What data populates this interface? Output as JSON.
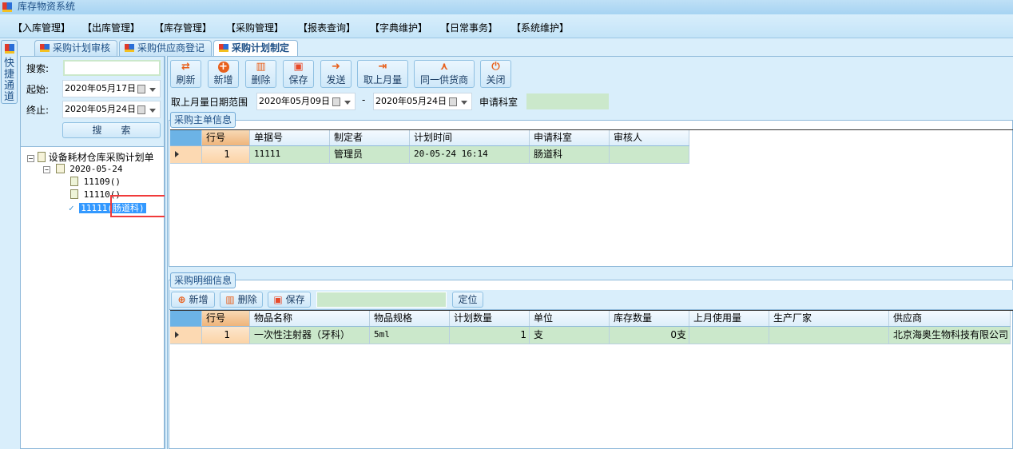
{
  "app": {
    "title": "库存物资系统"
  },
  "menu": [
    "【入库管理】",
    "【出库管理】",
    "【库存管理】",
    "【采购管理】",
    "【报表查询】",
    "【字典维护】",
    "【日常事务】",
    "【系统维护】"
  ],
  "quick_access": "快捷通道",
  "tabs": [
    "采购计划审核",
    "采购供应商登记",
    "采购计划制定"
  ],
  "search": {
    "search_label": "搜索:",
    "search_value": "",
    "start_label": "起始:",
    "start_date": "2020年05月17日",
    "end_label": "终止:",
    "end_date": "2020年05月24日",
    "search_button": "搜　　索"
  },
  "tree": {
    "root": "设备耗材仓库采购计划单",
    "date": "2020-05-24",
    "items": [
      "11109()",
      "11110()",
      "11111(肠道科)"
    ]
  },
  "toolbar": [
    "刷新",
    "新增",
    "删除",
    "保存",
    "发送",
    "取上月量",
    "同一供货商",
    "关闭"
  ],
  "filter": {
    "range_label": "取上月量日期范围",
    "from": "2020年05月09日",
    "sep": "-",
    "to": "2020年05月24日",
    "dept_label": "申请科室",
    "dept_value": ""
  },
  "master": {
    "title": "采购主单信息",
    "columns": [
      "行号",
      "单据号",
      "制定者",
      "计划时间",
      "申请科室",
      "审核人"
    ],
    "rows": [
      [
        "1",
        "11111",
        "管理员",
        "20-05-24 16:14",
        "肠道科",
        ""
      ]
    ]
  },
  "detail": {
    "title": "采购明细信息",
    "buttons": [
      "新增",
      "删除",
      "保存"
    ],
    "locate_value": "",
    "locate_button": "定位",
    "columns": [
      "行号",
      "物品名称",
      "物品规格",
      "计划数量",
      "单位",
      "库存数量",
      "上月使用量",
      "生产厂家",
      "供应商"
    ],
    "rows": [
      [
        "1",
        "一次性注射器（牙科）",
        "5ml",
        "1",
        "支",
        "0支",
        "",
        "",
        "北京海奥生物科技有限公司"
      ]
    ]
  }
}
